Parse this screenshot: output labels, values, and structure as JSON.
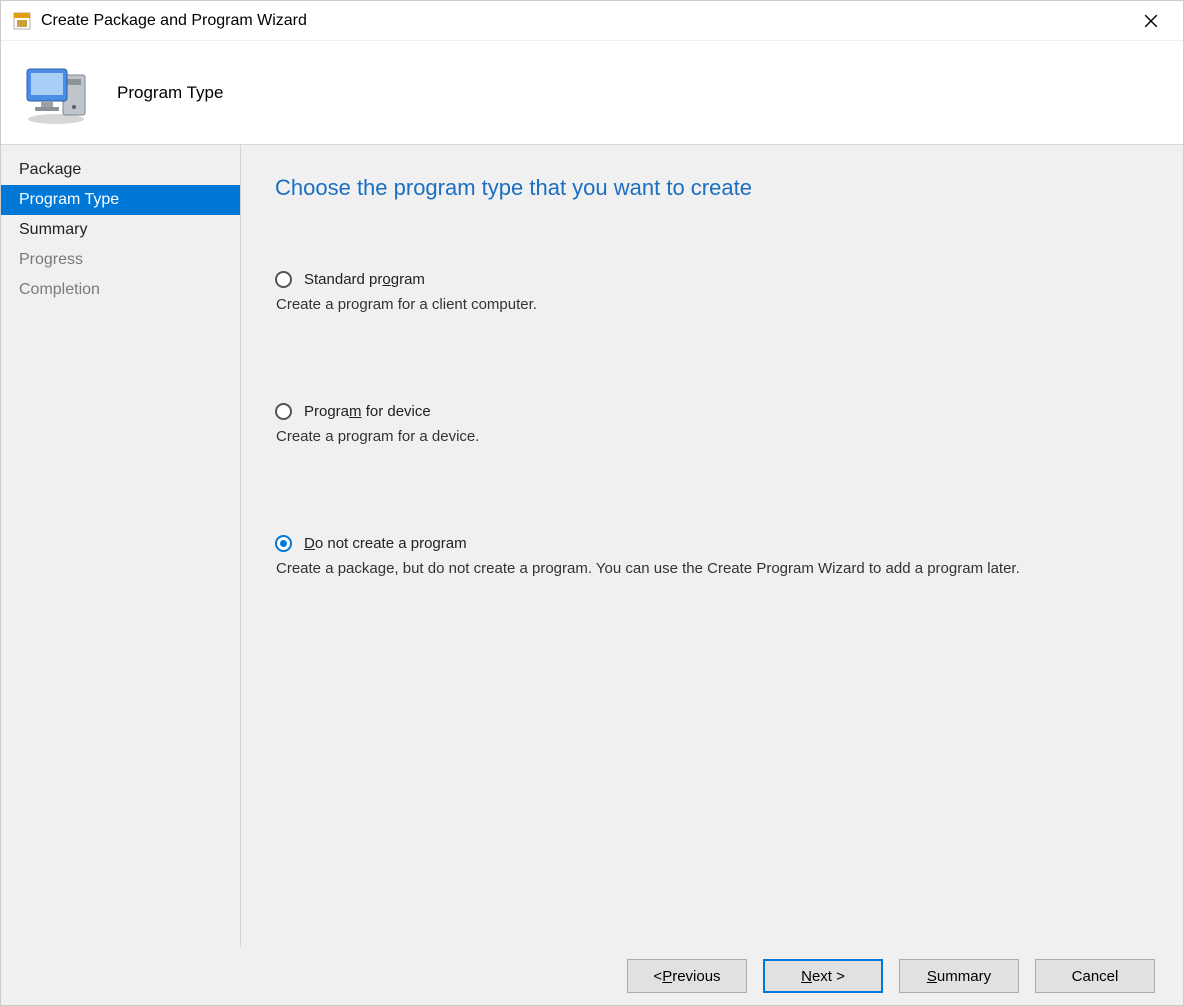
{
  "window": {
    "title": "Create Package and Program Wizard"
  },
  "header": {
    "title": "Program Type"
  },
  "sidebar": {
    "items": [
      {
        "label": "Package",
        "state": "clickable"
      },
      {
        "label": "Program Type",
        "state": "active"
      },
      {
        "label": "Summary",
        "state": "clickable"
      },
      {
        "label": "Progress",
        "state": "disabled"
      },
      {
        "label": "Completion",
        "state": "disabled"
      }
    ]
  },
  "main": {
    "heading": "Choose the program type that you want to create",
    "options": [
      {
        "label": "Standard program",
        "mnemonic_index": 12,
        "desc": "Create a program for a client computer.",
        "selected": false
      },
      {
        "label": "Program for device",
        "mnemonic_index": 6,
        "desc": "Create a program for a device.",
        "selected": false
      },
      {
        "label": "Do not create a program",
        "mnemonic_index": 0,
        "desc": "Create a package, but do not create a program. You can use the Create Program Wizard to add a program later.",
        "selected": true
      }
    ]
  },
  "footer": {
    "previous": "< Previous",
    "next": "Next >",
    "summary": "Summary",
    "cancel": "Cancel"
  }
}
